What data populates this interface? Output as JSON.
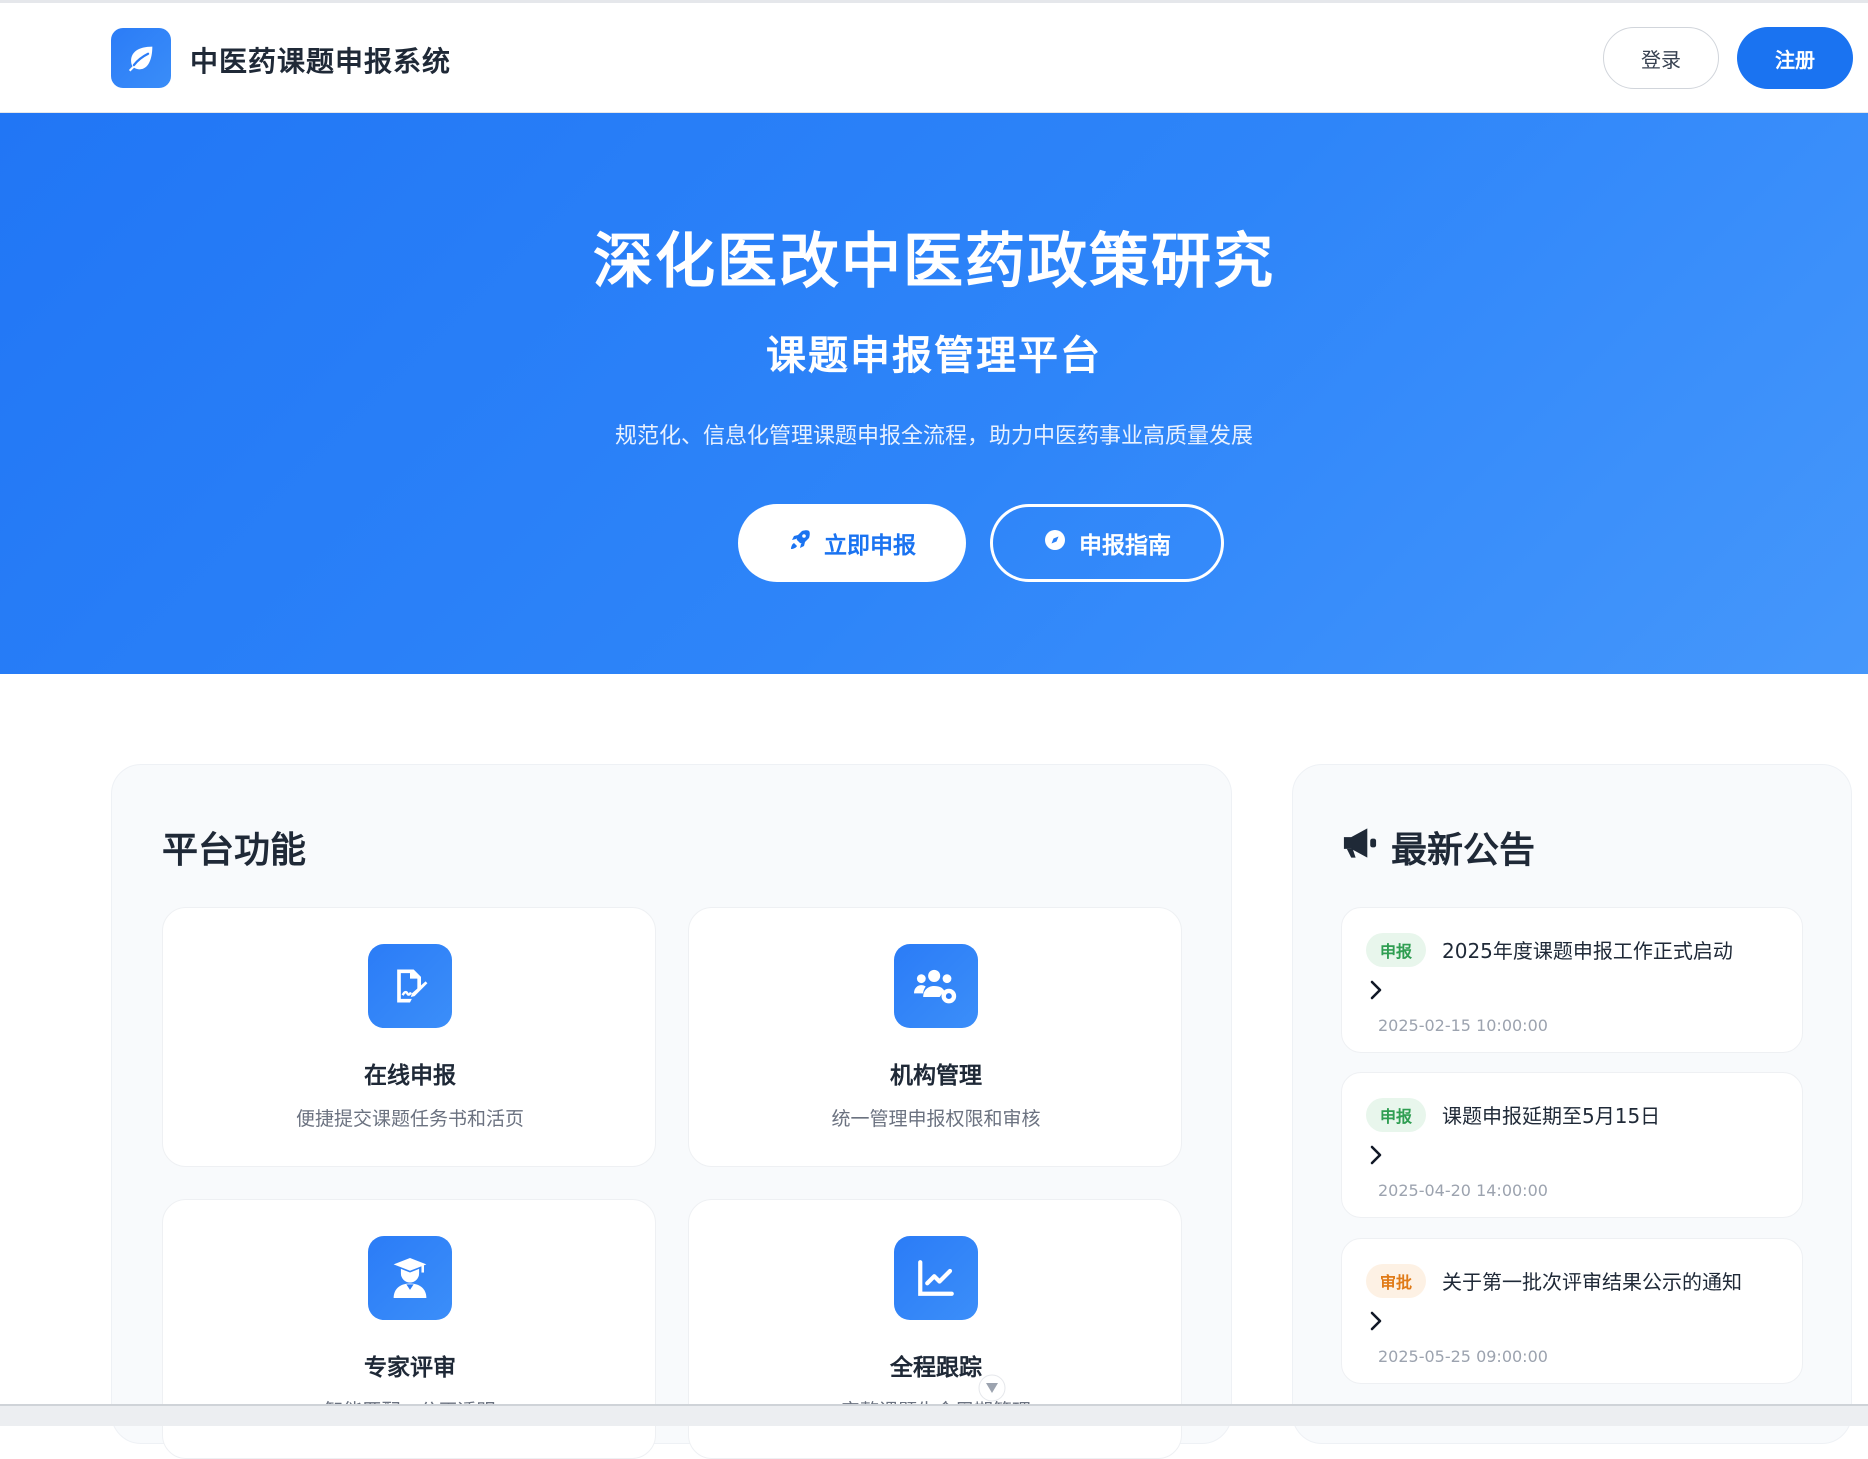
{
  "header": {
    "brand": "中医药课题申报系统",
    "login_label": "登录",
    "register_label": "注册"
  },
  "hero": {
    "title": "深化医改中医药政策研究",
    "subtitle": "课题申报管理平台",
    "description": "规范化、信息化管理课题申报全流程，助力中医药事业高质量发展",
    "primary_button": "立即申报",
    "secondary_button": "申报指南"
  },
  "features": {
    "title": "平台功能",
    "items": [
      {
        "icon": "file-signature-icon",
        "title": "在线申报",
        "desc": "便捷提交课题任务书和活页"
      },
      {
        "icon": "users-cog-icon",
        "title": "机构管理",
        "desc": "统一管理申报权限和审核"
      },
      {
        "icon": "expert-icon",
        "title": "专家评审",
        "desc": "智能匹配，公正透明"
      },
      {
        "icon": "chart-line-icon",
        "title": "全程跟踪",
        "desc": "完整课题生命周期管理"
      }
    ]
  },
  "notices": {
    "title": "最新公告",
    "items": [
      {
        "tag": "申报",
        "title": "2025年度课题申报工作正式启动",
        "time": "2025-02-15 10:00:00"
      },
      {
        "tag": "申报",
        "title": "课题申报延期至5月15日",
        "time": "2025-04-20 14:00:00"
      },
      {
        "tag": "审批",
        "title": "关于第一批次评审结果公示的通知",
        "time": "2025-05-25 09:00:00"
      }
    ]
  },
  "colors": {
    "primary": "#1a73f1",
    "hero_start": "#2176f5",
    "hero_end": "#4597fb",
    "tag_green": "#2f9e52",
    "tag_orange": "#e07b18"
  }
}
